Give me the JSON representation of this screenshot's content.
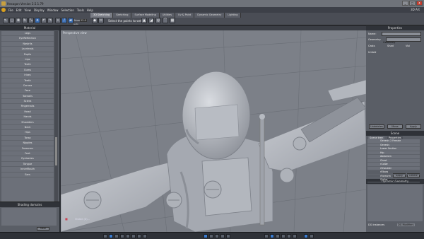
{
  "window": {
    "title": "Hexagon Version 2.5.1.79",
    "minimize": "_",
    "maximize": "□",
    "close": "X"
  },
  "menu": {
    "items": [
      "File",
      "Edit",
      "View",
      "Display",
      "Window",
      "Selection",
      "Tools",
      "Help"
    ],
    "right_label": "3D Art"
  },
  "toolbar": {
    "tabs": [
      "3D Sketching",
      "Sketching",
      "Surface Modeling",
      "Utilities",
      "Uv & Paint",
      "Dynamic Geometry",
      "Lighting"
    ],
    "hint": "Select the points to weld",
    "numeric_label": "Num",
    "numeric_value": "22.0",
    "auto_label": "auto"
  },
  "left_panel": {
    "title": "Material",
    "materials": [
      "Legs",
      "EyeReflection",
      "Nostrils",
      "Lacrimals",
      "Pupils",
      "Lips",
      "Teeth",
      "Gums",
      "Irises",
      "Teeth",
      "Cornea",
      "Face",
      "Toenails",
      "Sclera",
      "Fingernails",
      "Head",
      "Hands",
      "Shoulders",
      "Neck",
      "Hips",
      "Torso",
      "Nipples",
      "Forearms",
      "Feet",
      "Eyelashes",
      "Tongue",
      "InnerMouth",
      "Ears"
    ],
    "new_button": "New",
    "shading_title": "Shading domains",
    "shading_new": "New"
  },
  "viewport": {
    "label": "Perspective view",
    "axis_label": "Visible (X)..."
  },
  "right_panel": {
    "title": "Properties",
    "name_label": "Name:",
    "name_value": "Geometry",
    "geometry_label": "Geometry:",
    "checks": [
      "Casts",
      "Shad",
      "Visi"
    ],
    "unfold": "Unfold",
    "buttons": [
      "Undeletes",
      "Move",
      "Apply"
    ],
    "scene_title": "Scene",
    "scene_tabs": [
      "Scene tree",
      "Properties"
    ],
    "scene_items": [
      "Genesis 2 Female",
      "Genesis",
      "Lower Section",
      "Hip",
      "Abdomen",
      "Chest",
      "rCollar",
      "rShoulder",
      "rElbow",
      "rForearm",
      "lCollar"
    ],
    "scene_btn1": "Apply",
    "scene_btn2": "Delete",
    "dynamic_title": "Dynamic Geometry",
    "bottom_left": "DG Instances",
    "bottom_right": "DG Modifiers"
  }
}
